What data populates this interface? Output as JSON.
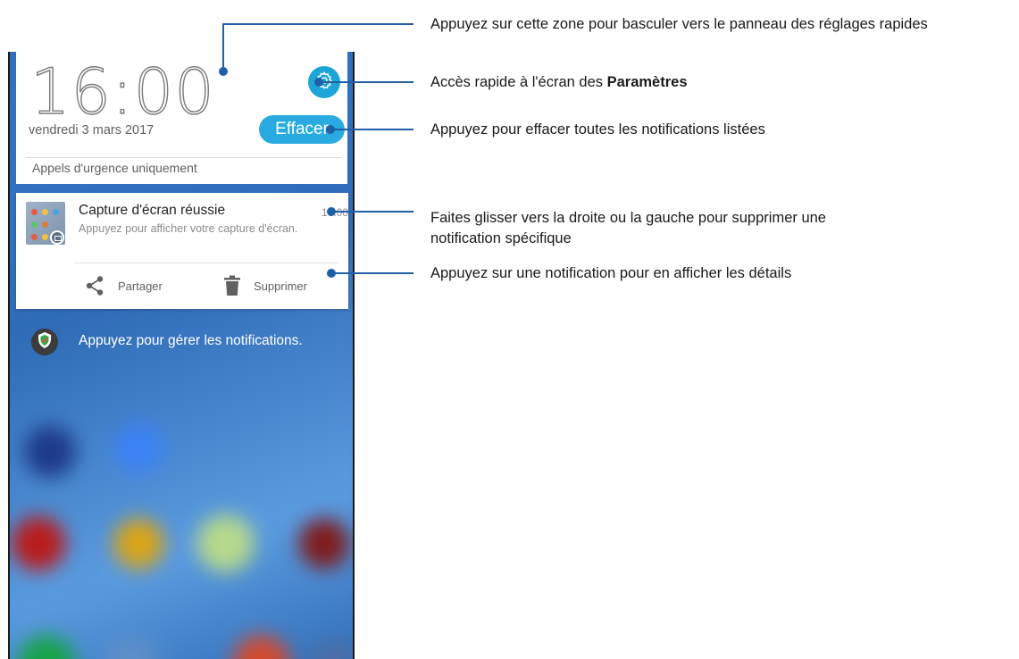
{
  "phone": {
    "clock": "16:00",
    "date": "vendredi 3 mars 2017",
    "clear_label": "Effacer",
    "emergency": "Appels d'urgence uniquement",
    "notification": {
      "title": "Capture d'écran réussie",
      "time": "16:00",
      "body": "Appuyez pour afficher votre capture d'écran.",
      "share_label": "Partager",
      "delete_label": "Supprimer"
    },
    "manage_label": "Appuyez pour gérer les notifications."
  },
  "callouts": {
    "quick_settings": "Appuyez sur cette zone pour basculer vers le panneau des réglages rapides",
    "settings_prefix": "Accès rapide à l'écran des ",
    "settings_bold": "Paramètres",
    "clear": "Appuyez pour effacer toutes les notifications listées",
    "swipe_line1": "Faites glisser vers la droite ou la gauche pour supprimer une",
    "swipe_line2": "notification spécifique",
    "tap": "Appuyez sur une notification pour en afficher les détails"
  },
  "colors": {
    "accent": "#29abe2",
    "callout_line": "#1f5fa6"
  },
  "icons": [
    "gear-icon",
    "share-icon",
    "trash-icon",
    "shield-icon"
  ]
}
